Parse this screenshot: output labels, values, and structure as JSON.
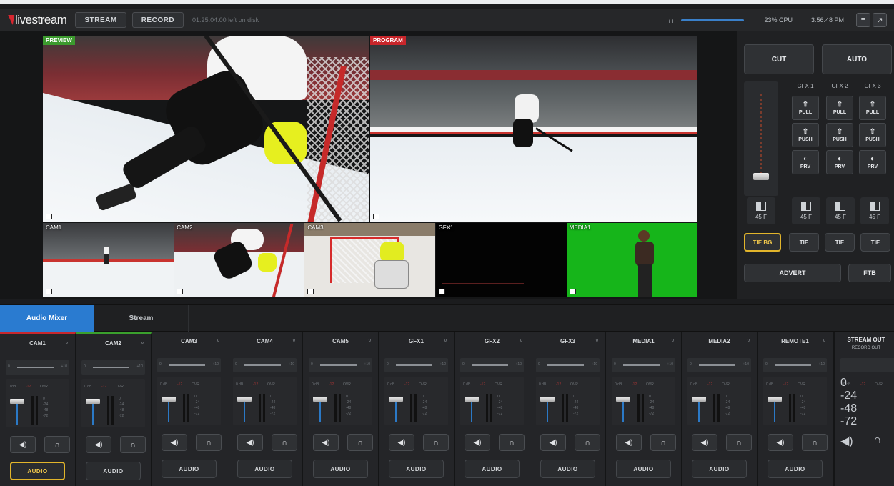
{
  "app": {
    "logo": "livestream"
  },
  "topbar": {
    "stream_label": "STREAM",
    "record_label": "RECORD",
    "disk_text": "01:25:04:00  left on disk",
    "cpu": "23% CPU",
    "clock": "3:56:48 PM"
  },
  "monitors": {
    "preview_label": "PREVIEW",
    "program_label": "PROGRAM"
  },
  "sources": [
    {
      "label": "CAM1"
    },
    {
      "label": "CAM2"
    },
    {
      "label": "CAM3"
    },
    {
      "label": "GFX1"
    },
    {
      "label": "MEDIA1"
    }
  ],
  "controls": {
    "cut_label": "CUT",
    "auto_label": "AUTO",
    "gfx": [
      {
        "header": "GFX 1",
        "pull": "PULL",
        "push": "PUSH",
        "prv": "PRV",
        "fade": "45 F",
        "tie": "TIE"
      },
      {
        "header": "GFX 2",
        "pull": "PULL",
        "push": "PUSH",
        "prv": "PRV",
        "fade": "45 F",
        "tie": "TIE"
      },
      {
        "header": "GFX 3",
        "pull": "PULL",
        "push": "PUSH",
        "prv": "PRV",
        "fade": "45 F",
        "tie": "TIE"
      }
    ],
    "bg_fade": "45 F",
    "tie_bg": "TIE BG",
    "advert": "ADVERT",
    "ftb": "FTB"
  },
  "tabs": [
    {
      "label": "Audio Mixer"
    },
    {
      "label": "Stream"
    }
  ],
  "mixer": {
    "gain_min": "0",
    "gain_max": "+10",
    "meter_left": "0 dB",
    "meter_mid": "-12",
    "meter_right": "OVR",
    "scale": [
      "0",
      "-24",
      "-48",
      "-72"
    ],
    "audio_label": "AUDIO",
    "speaker_icon": "◀)",
    "headphone_icon": "∩",
    "channels": [
      {
        "name": "CAM1"
      },
      {
        "name": "CAM2"
      },
      {
        "name": "CAM3"
      },
      {
        "name": "CAM4"
      },
      {
        "name": "CAM5"
      },
      {
        "name": "GFX1"
      },
      {
        "name": "GFX2"
      },
      {
        "name": "GFX3"
      },
      {
        "name": "MEDIA1"
      },
      {
        "name": "MEDIA2"
      },
      {
        "name": "REMOTE1"
      }
    ],
    "stream_out": {
      "name": "STREAM OUT",
      "sub": "RECORD OUT"
    }
  }
}
